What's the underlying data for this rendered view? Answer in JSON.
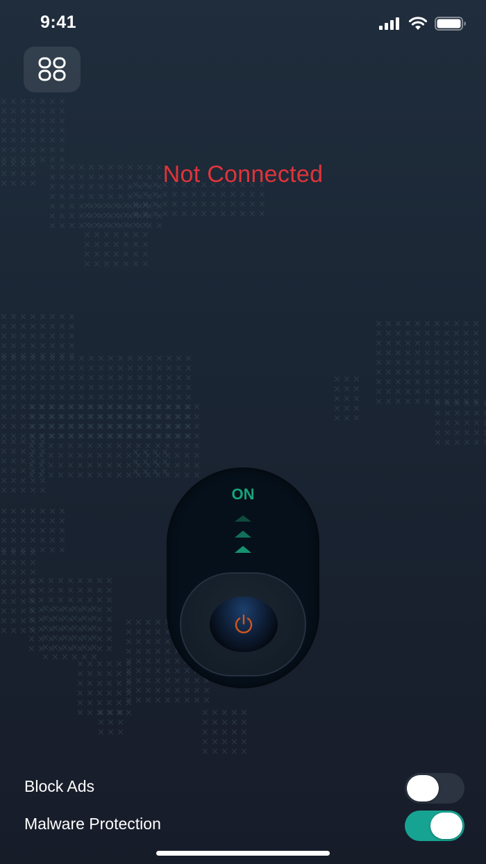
{
  "status_bar": {
    "time": "9:41",
    "icons": [
      "signal-icon",
      "wifi-icon",
      "battery-icon"
    ]
  },
  "header": {
    "menu_icon": "grid-icon"
  },
  "connection": {
    "status_text": "Not Connected",
    "status_color": "#e0343a"
  },
  "power_toggle": {
    "on_label": "ON",
    "icon": "power-icon",
    "accent_color": "#17a37a",
    "power_icon_color": "#d4561c"
  },
  "settings": {
    "block_ads": {
      "label": "Block Ads",
      "enabled": false
    },
    "malware_protection": {
      "label": "Malware Protection",
      "enabled": true
    }
  },
  "colors": {
    "switch_on": "#17a392",
    "switch_off": "#2b3440"
  }
}
